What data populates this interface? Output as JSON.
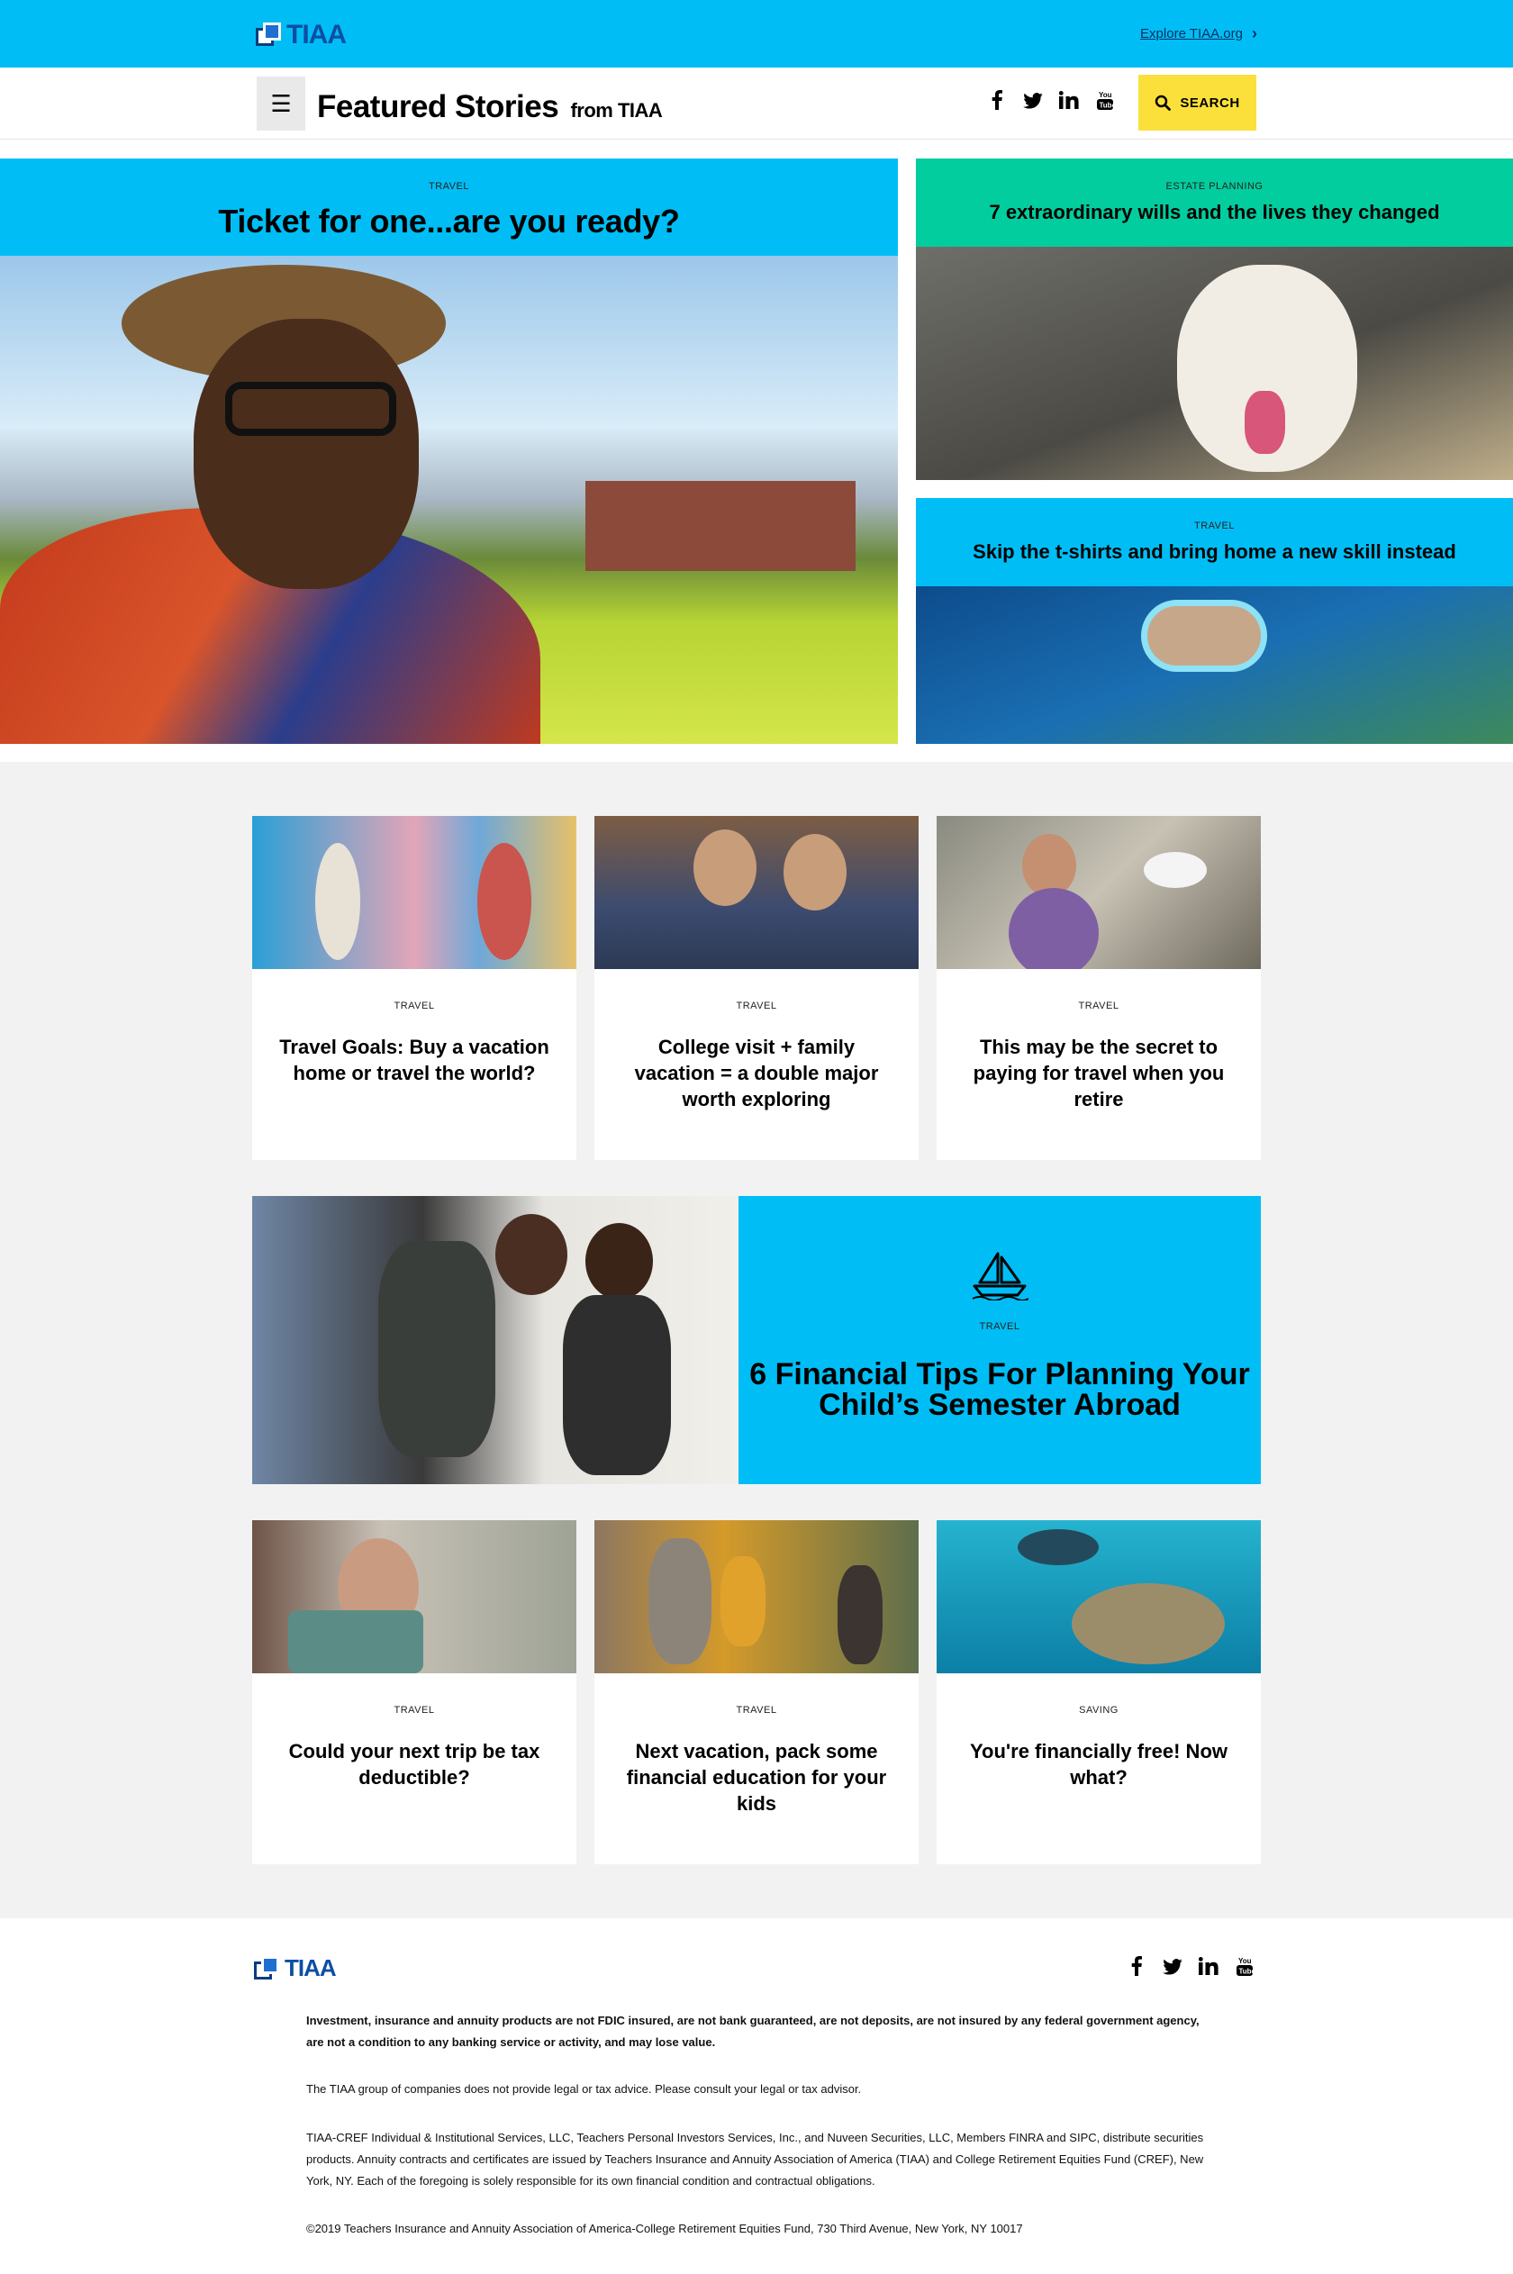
{
  "topbar": {
    "logo_text": "TIAA",
    "explore_link": "Explore TIAA.org"
  },
  "header": {
    "menu_icon": "☰",
    "title": "Featured Stories",
    "title_suffix": "from TIAA",
    "social": [
      "f",
      "t",
      "in",
      "yt"
    ],
    "search_label": "SEARCH"
  },
  "hero": {
    "main": {
      "kicker": "TRAVEL",
      "title": "Ticket for one...are you ready?"
    },
    "side1": {
      "kicker": "ESTATE PLANNING",
      "title": "7 extraordinary wills and the lives they changed"
    },
    "side2": {
      "kicker": "TRAVEL",
      "title": "Skip the t-shirts and bring home a new skill instead"
    }
  },
  "cards_row1": [
    {
      "kicker": "TRAVEL",
      "title": "Travel Goals: Buy a vacation home or travel the world?"
    },
    {
      "kicker": "TRAVEL",
      "title": "College visit + family vacation = a double major worth exploring"
    },
    {
      "kicker": "TRAVEL",
      "title": "This may be the secret to paying for travel when you retire"
    }
  ],
  "feature": {
    "icon": "sailboat-icon",
    "kicker": "TRAVEL",
    "title": "6 Financial Tips For Planning Your Child’s Semester Abroad"
  },
  "cards_row2": [
    {
      "kicker": "TRAVEL",
      "title": "Could your next trip be tax deductible?"
    },
    {
      "kicker": "TRAVEL",
      "title": "Next vacation, pack some financial education for your kids"
    },
    {
      "kicker": "SAVING",
      "title": "You're financially free! Now what?"
    }
  ],
  "footer": {
    "logo_text": "TIAA",
    "disclaimer": "Investment, insurance and annuity products are not FDIC insured, are not bank guaranteed, are not deposits, are not insured by any federal government agency, are not a condition to any banking service or activity, and may lose value.",
    "advice": "The TIAA group of companies does not provide legal or tax advice. Please consult your legal or tax advisor.",
    "securities": "TIAA-CREF Individual & Institutional Services, LLC, Teachers Personal Investors Services, Inc., and Nuveen Securities, LLC, Members FINRA and SIPC, distribute securities products. Annuity contracts and certificates are issued by Teachers Insurance and Annuity Association of America (TIAA) and College Retirement Equities Fund (CREF), New York, NY. Each of the foregoing is solely responsible for its own financial condition and contractual obligations.",
    "copyright": "©2019 Teachers Insurance and Annuity Association of America-College Retirement Equities Fund, 730 Third Avenue, New York, NY 10017"
  },
  "colors": {
    "brand_cyan": "#00bef5",
    "estate_green": "#02cd9e",
    "search_yellow": "#fbe03b",
    "section_grey": "#f2f2f2"
  }
}
